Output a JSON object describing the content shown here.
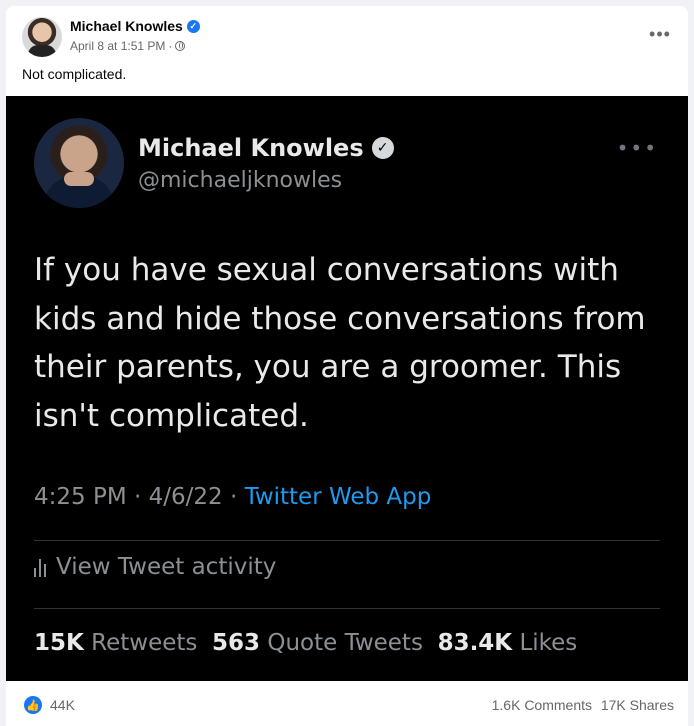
{
  "post": {
    "author": "Michael Knowles",
    "timestamp": "April 8 at 1:51 PM",
    "separator": "·",
    "caption": "Not complicated.",
    "more": "•••"
  },
  "tweet": {
    "name": "Michael Knowles",
    "handle": "@michaeljknowles",
    "text": "If you have sexual conversations with kids and hide those conversations from their parents, you are a groomer. This isn't complicated.",
    "time": "4:25 PM · 4/6/22 · ",
    "source": "Twitter Web App",
    "activity_label": "View Tweet activity",
    "retweets_count": "15K",
    "retweets_label": "Retweets",
    "quotes_count": "563",
    "quotes_label": "Quote Tweets",
    "likes_count": "83.4K",
    "likes_label": "Likes",
    "more": "•••"
  },
  "footer": {
    "reactions": "44K",
    "comments": "1.6K Comments",
    "shares": "17K Shares"
  },
  "colors": {
    "facebook_blue": "#1877f2",
    "twitter_blue": "#1d9bf0",
    "tweet_bg": "#000000"
  },
  "icons": [
    "verified-icon",
    "globe-icon",
    "more-icon",
    "activity-bars-icon",
    "like-reaction-icon"
  ]
}
